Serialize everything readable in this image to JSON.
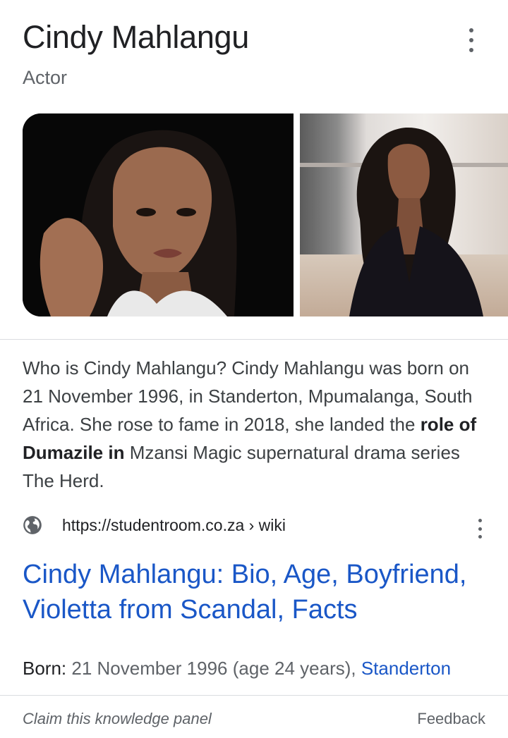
{
  "panel": {
    "title": "Cindy Mahlangu",
    "subtitle": "Actor",
    "images": [
      {
        "alt": "Cindy Mahlangu portrait"
      },
      {
        "alt": "Cindy Mahlangu photo"
      }
    ]
  },
  "description": {
    "part1": "Who is Cindy Mahlangu? Cindy Mahlangu was born on 21 November 1996, in Standerton, Mpumalanga, South Africa. She rose to fame in 2018, she landed the ",
    "bold": "role of Dumazile in",
    "part2": " Mzansi Magic supernatural drama series The Herd."
  },
  "source": {
    "url": "https://studentroom.co.za › wiki",
    "link_title": "Cindy Mahlangu: Bio, Age, Boyfriend, Violetta from Scandal, Facts"
  },
  "facts": {
    "born_label": "Born:",
    "born_value": " 21 November 1996 (age 24 years), ",
    "born_place": "Standerton"
  },
  "footer": {
    "claim": "Claim this knowledge panel",
    "feedback": "Feedback"
  },
  "colors": {
    "link": "#1a57c7",
    "text": "#202124",
    "secondary": "#5f6368",
    "divider": "#dadce0"
  },
  "icons": {
    "more": "more-vert-icon",
    "globe": "globe-icon"
  }
}
